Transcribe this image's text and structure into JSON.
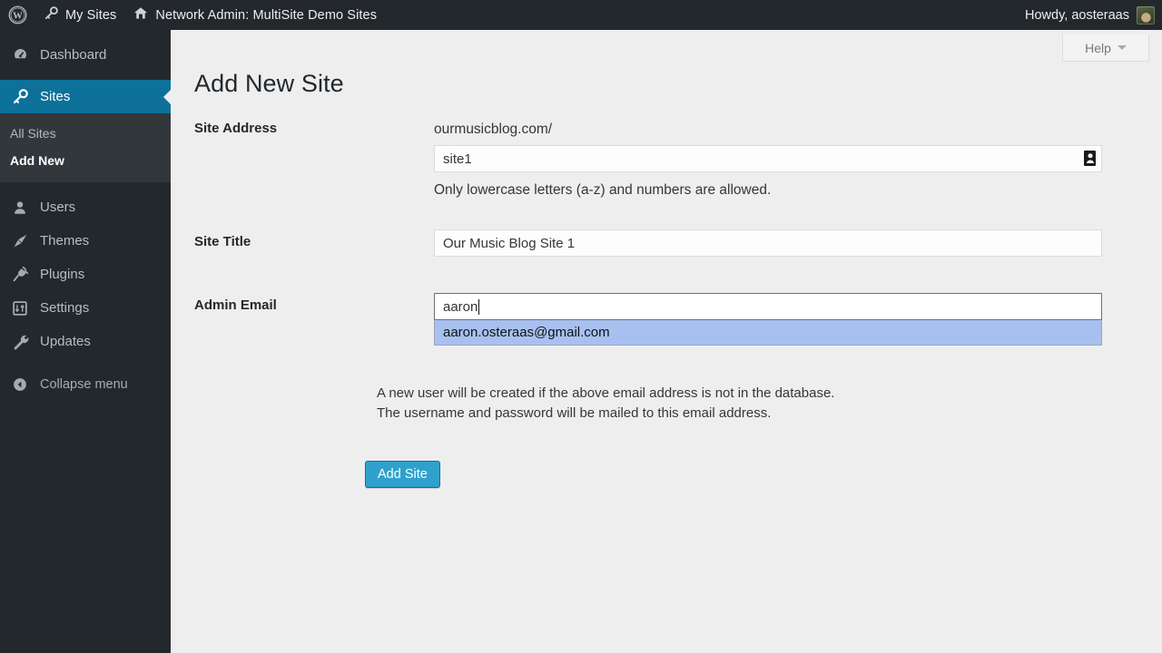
{
  "adminbar": {
    "wp_logo_name": "wordpress-logo-icon",
    "my_sites": "My Sites",
    "my_sites_icon": "key-icon",
    "network_admin": "Network Admin: MultiSite Demo Sites",
    "network_icon": "home-icon",
    "howdy": "Howdy, aosteraas",
    "avatar_name": "user-avatar"
  },
  "sidebar": {
    "items": [
      {
        "label": "Dashboard",
        "icon": "dashboard-icon",
        "current": false
      },
      {
        "label": "Sites",
        "icon": "key-icon",
        "current": true
      },
      {
        "label": "Users",
        "icon": "user-icon",
        "current": false
      },
      {
        "label": "Themes",
        "icon": "brush-icon",
        "current": false
      },
      {
        "label": "Plugins",
        "icon": "plug-icon",
        "current": false
      },
      {
        "label": "Settings",
        "icon": "settings-icon",
        "current": false
      },
      {
        "label": "Updates",
        "icon": "wrench-icon",
        "current": false
      }
    ],
    "submenu": [
      {
        "label": "All Sites",
        "current": false
      },
      {
        "label": "Add New",
        "current": true
      }
    ],
    "collapse": {
      "label": "Collapse menu",
      "icon": "collapse-arrow-icon"
    }
  },
  "content": {
    "help_button": "Help",
    "help_caret_icon": "chevron-down-icon",
    "page_title": "Add New Site",
    "fields": {
      "site_address": {
        "label": "Site Address",
        "domain_prefix": "ourmusicblog.com/",
        "value": "site1",
        "hint": "Only lowercase letters (a-z) and numbers are allowed.",
        "autofill_icon": "password-manager-icon"
      },
      "site_title": {
        "label": "Site Title",
        "value": "Our Music Blog Site 1",
        "placeholder": ""
      },
      "admin_email": {
        "label": "Admin Email",
        "value": "aaron",
        "placeholder": "",
        "suggestions": [
          "aaron.osteraas@gmail.com"
        ]
      }
    },
    "note_line_1": "A new user will be created if the above email address is not in the database.",
    "note_line_2": "The username and password will be mailed to this email address.",
    "submit_label": "Add Site"
  },
  "colors": {
    "admin_bar": "#23282d",
    "sidebar": "#23282d",
    "submenu": "#32373c",
    "current_menu": "#0d7199",
    "button": "#2ea2cc",
    "button_border": "#0074a2",
    "autocomplete_highlight": "#a8c0f0",
    "content_bg": "#eeeeee"
  }
}
